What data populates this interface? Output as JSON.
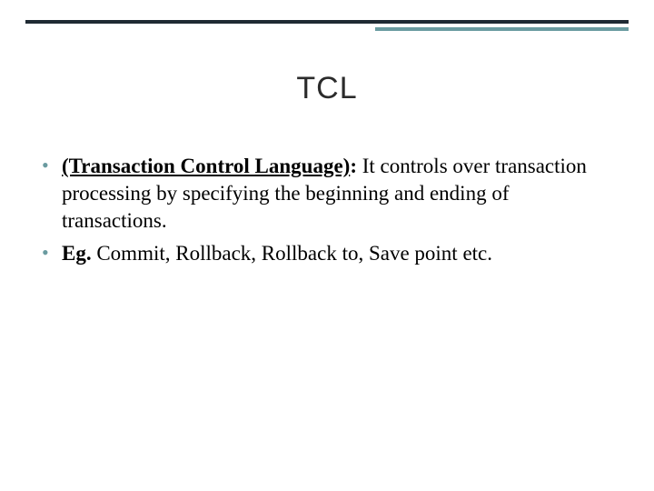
{
  "title": "TCL",
  "bullets": [
    {
      "term": "(Transaction Control Language)",
      "colon": ":",
      "text": " It controls over transaction processing by specifying the beginning and ending of transactions."
    },
    {
      "label": "Eg.",
      "text": " Commit, Rollback, Rollback to, Save point etc."
    }
  ],
  "colors": {
    "rule_dark": "#1f2a33",
    "rule_teal": "#6a9ba0",
    "bullet": "#6a9ba0"
  }
}
